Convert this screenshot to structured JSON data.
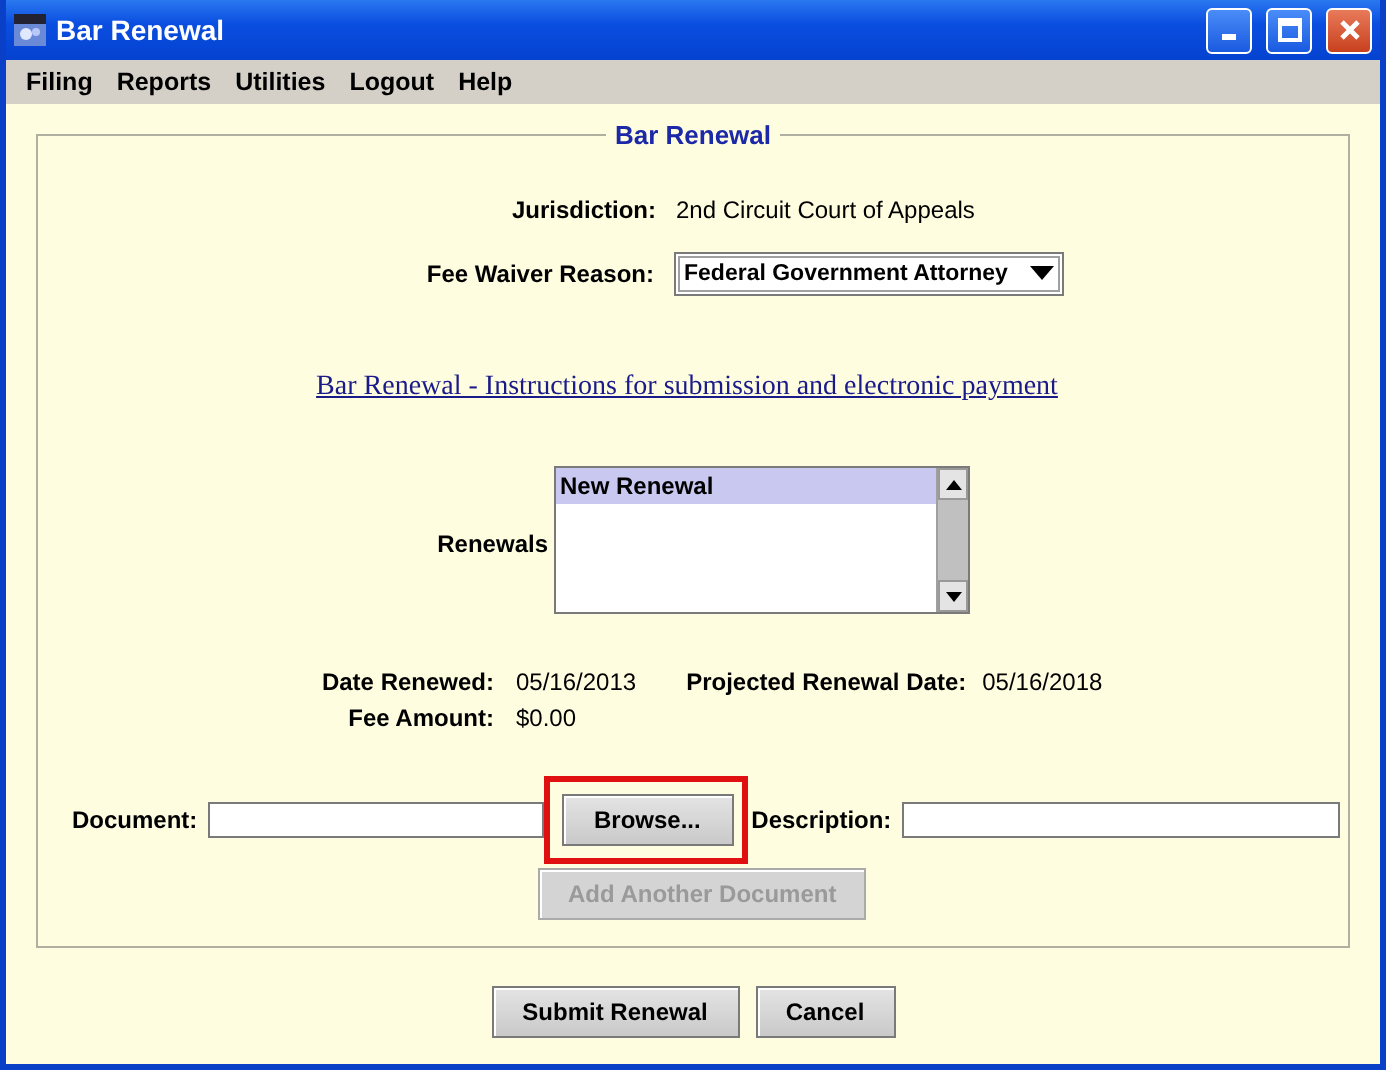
{
  "window": {
    "title": "Bar Renewal"
  },
  "menu": [
    {
      "label": "Filing"
    },
    {
      "label": "Reports"
    },
    {
      "label": "Utilities"
    },
    {
      "label": "Logout"
    },
    {
      "label": "Help"
    }
  ],
  "form": {
    "legend": "Bar Renewal",
    "jurisdiction": {
      "label": "Jurisdiction:",
      "value": "2nd Circuit Court of Appeals"
    },
    "fee_waiver": {
      "label": "Fee Waiver Reason:",
      "value": "Federal Government Attorney"
    },
    "link": "Bar Renewal - Instructions for submission and electronic payment",
    "renewals": {
      "label": "Renewals",
      "items": [
        {
          "label": "New Renewal",
          "selected": true
        }
      ]
    },
    "date_renewed": {
      "label": "Date Renewed:",
      "value": "05/16/2013"
    },
    "projected": {
      "label": "Projected Renewal Date:",
      "value": "05/16/2018"
    },
    "fee_amount": {
      "label": "Fee Amount:",
      "value": "$0.00"
    },
    "document": {
      "label": "Document:"
    },
    "browse": {
      "label": "Browse...",
      "highlighted": true
    },
    "description": {
      "label": "Description:"
    },
    "add_document": {
      "label": "Add Another Document",
      "disabled": true
    }
  },
  "buttons": [
    {
      "label": "Submit Renewal"
    },
    {
      "label": "Cancel"
    }
  ]
}
